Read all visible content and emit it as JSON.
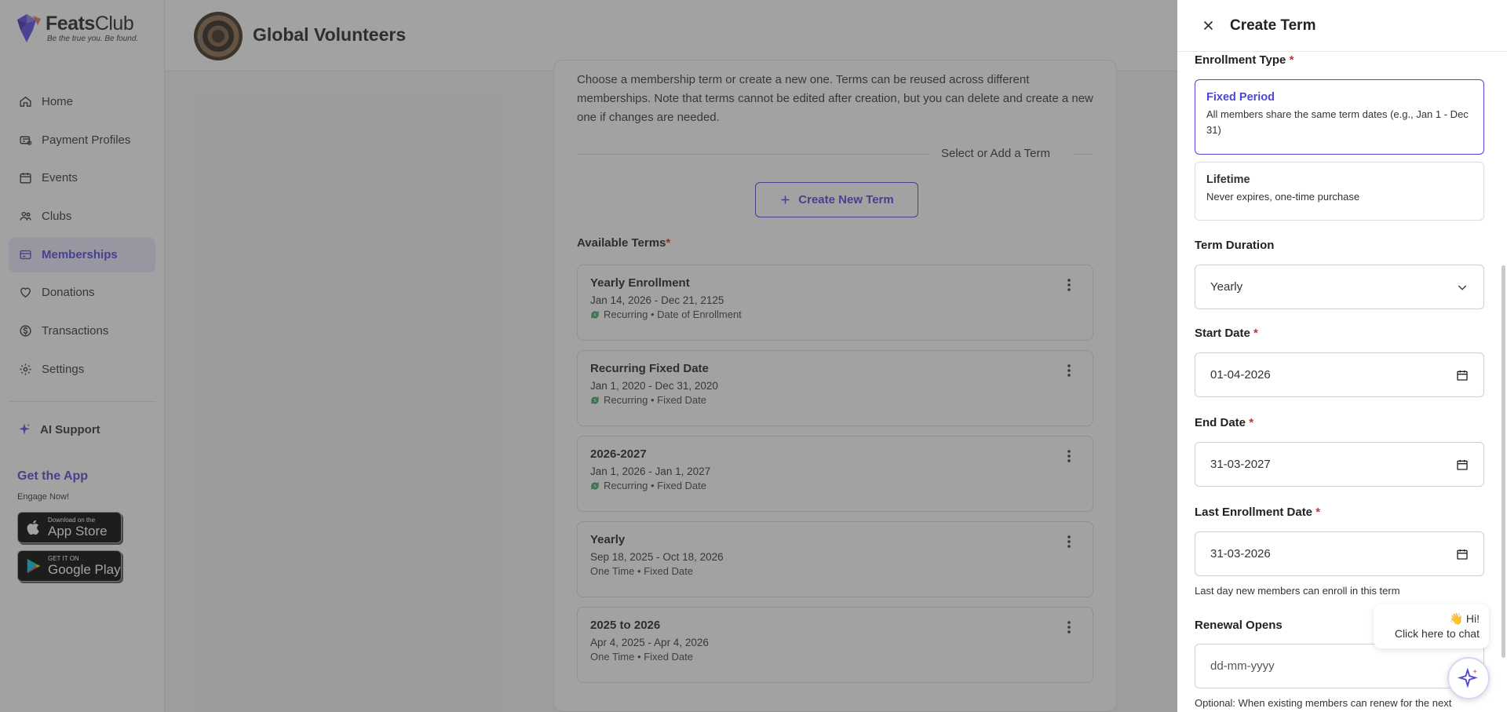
{
  "app": {
    "logo_name_bold": "Feats",
    "logo_name_light": "Club",
    "logo_tagline": "Be the true you. Be found."
  },
  "sidebar": {
    "items": [
      {
        "label": "Home",
        "icon": "home-icon"
      },
      {
        "label": "Payment Profiles",
        "icon": "payment-profiles-icon"
      },
      {
        "label": "Events",
        "icon": "calendar-icon"
      },
      {
        "label": "Clubs",
        "icon": "clubs-icon"
      },
      {
        "label": "Memberships",
        "icon": "memberships-icon",
        "active": true
      },
      {
        "label": "Donations",
        "icon": "heart-icon"
      },
      {
        "label": "Transactions",
        "icon": "dollar-icon"
      },
      {
        "label": "Settings",
        "icon": "gear-icon"
      }
    ],
    "ai_support": "AI Support",
    "get_app_title": "Get the App",
    "get_app_sub": "Engage Now!",
    "app_store_small": "Download on the",
    "app_store_big": "App Store",
    "google_play_small": "GET IT ON",
    "google_play_big": "Google Play"
  },
  "header": {
    "club_name": "Global Volunteers"
  },
  "main": {
    "description": "Choose a membership term or create a new one. Terms can be reused across different memberships. Note that terms cannot be edited after creation, but you can delete and create a new one if changes are needed.",
    "separator_label": "Select or Add a Term",
    "create_button": "Create New Term",
    "available_label": "Available Terms",
    "required_mark": "*",
    "terms": [
      {
        "title": "Yearly Enrollment",
        "dates": "Jan 14, 2026 - Dec 21, 2125",
        "meta": "Recurring • Date of Enrollment",
        "recurring": true
      },
      {
        "title": "Recurring Fixed Date",
        "dates": "Jan 1, 2020 - Dec 31, 2020",
        "meta": "Recurring • Fixed Date",
        "recurring": true
      },
      {
        "title": "2026-2027",
        "dates": "Jan 1, 2026 - Jan 1, 2027",
        "meta": "Recurring • Fixed Date",
        "recurring": true
      },
      {
        "title": "Yearly",
        "dates": "Sep 18, 2025 - Oct 18, 2026",
        "meta": "One Time • Fixed Date",
        "recurring": false
      },
      {
        "title": "2025 to 2026",
        "dates": "Apr 4, 2025 - Apr 4, 2026",
        "meta": "One Time • Fixed Date",
        "recurring": false
      }
    ]
  },
  "drawer": {
    "title": "Create Term",
    "enrollment_type_label": "Enrollment Type",
    "options": [
      {
        "title": "Fixed Period",
        "desc": "All members share the same term dates (e.g., Jan 1 - Dec 31)",
        "selected": true
      },
      {
        "title": "Lifetime",
        "desc": "Never expires, one-time purchase",
        "selected": false
      }
    ],
    "term_duration_label": "Term Duration",
    "term_duration_value": "Yearly",
    "start_date_label": "Start Date",
    "start_date_value": "01-04-2026",
    "end_date_label": "End Date",
    "end_date_value": "31-03-2027",
    "last_enrollment_label": "Last Enrollment Date",
    "last_enrollment_value": "31-03-2026",
    "last_enrollment_hint": "Last day new members can enroll in this term",
    "renewal_opens_label": "Renewal Opens",
    "renewal_opens_placeholder": "dd-mm-yyyy",
    "renewal_hint": "Optional: When existing members can renew for the next"
  },
  "chat": {
    "greeting": "👋 Hi!",
    "cta": "Click here to chat"
  },
  "colors": {
    "accent": "#4f46d6",
    "required": "#d62c2c",
    "recurring_icon": "#2e9c5a"
  }
}
